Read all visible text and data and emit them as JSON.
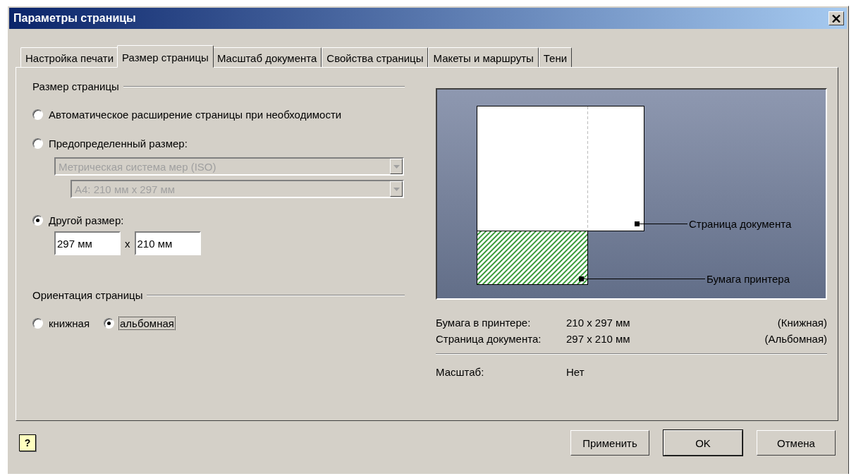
{
  "window": {
    "title": "Параметры страницы"
  },
  "tabs": [
    {
      "label": "Настройка печати",
      "selected": false
    },
    {
      "label": "Размер страницы",
      "selected": true
    },
    {
      "label": "Масштаб документа",
      "selected": false
    },
    {
      "label": "Свойства страницы",
      "selected": false
    },
    {
      "label": "Макеты и маршруты",
      "selected": false
    },
    {
      "label": "Тени",
      "selected": false
    }
  ],
  "page_size": {
    "heading": "Размер страницы",
    "options": [
      {
        "label": "Автоматическое расширение страницы при необходимости",
        "selected": false
      },
      {
        "label": "Предопределенный размер:",
        "selected": false
      },
      {
        "label": "Другой размер:",
        "selected": true
      }
    ],
    "standard_dropdown": {
      "value": "Метрическая система мер (ISO)",
      "disabled": true
    },
    "size_dropdown": {
      "value": "A4:  210 мм x 297 мм",
      "disabled": true
    },
    "width_field": {
      "value": "297 мм"
    },
    "separator": "x",
    "height_field": {
      "value": "210 мм"
    }
  },
  "orientation": {
    "heading": "Ориентация страницы",
    "options": [
      {
        "label": "книжная",
        "selected": false,
        "focused": false
      },
      {
        "label": "альбомная",
        "selected": true,
        "focused": true
      }
    ]
  },
  "preview": {
    "document_label": "Страница документа",
    "printer_label": "Бумага принтера"
  },
  "info": {
    "rows": [
      {
        "label": "Бумага в принтере:",
        "value": "210 x 297 мм",
        "orientation": "(Книжная)"
      },
      {
        "label": "Страница документа:",
        "value": "297 x 210 мм",
        "orientation": "(Альбомная)"
      }
    ],
    "scale_label": "Масштаб:",
    "scale_value": "Нет"
  },
  "help_button": {
    "label": "?"
  },
  "buttons": [
    {
      "label": "Применить",
      "default": false
    },
    {
      "label": "OK",
      "default": true
    },
    {
      "label": "Отмена",
      "default": false
    }
  ]
}
